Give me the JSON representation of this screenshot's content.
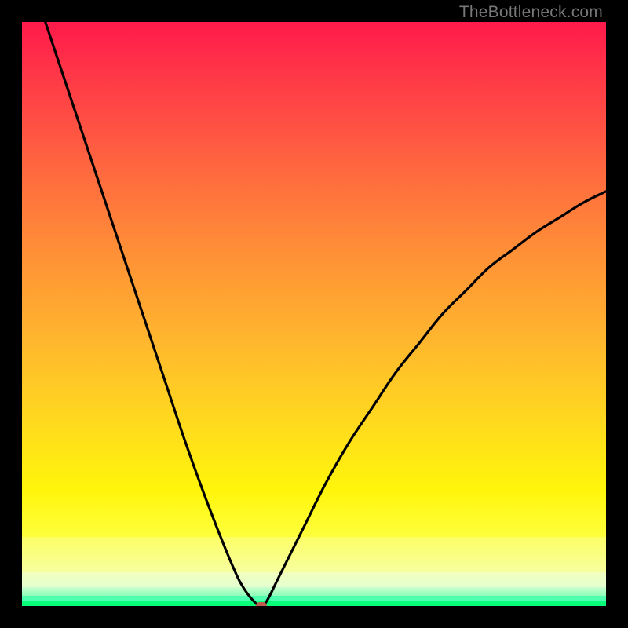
{
  "watermark": "TheBottleneck.com",
  "colors": {
    "frame": "#000000",
    "marker": "#c35a4f",
    "curve": "#000000",
    "grad_top": "#ff1a4b",
    "grad_mid": "#ffd81f",
    "grad_bottom": "#08ff7a"
  },
  "chart_data": {
    "type": "line",
    "title": "",
    "xlabel": "",
    "ylabel": "",
    "xlim": [
      0,
      100
    ],
    "ylim": [
      0,
      100
    ],
    "series": [
      {
        "name": "bottleneck-curve",
        "x": [
          4,
          8,
          12,
          16,
          20,
          24,
          28,
          32,
          36,
          38,
          40,
          41,
          42,
          44,
          48,
          52,
          56,
          60,
          64,
          68,
          72,
          76,
          80,
          84,
          88,
          92,
          96,
          100
        ],
        "y": [
          100,
          88,
          76,
          64,
          52,
          40,
          28,
          17,
          7,
          3,
          0.5,
          0,
          1,
          5,
          13,
          21,
          28,
          34,
          40,
          45,
          50,
          54,
          58,
          61,
          64,
          66.5,
          69,
          71
        ]
      }
    ],
    "marker_point": {
      "x": 41,
      "y": 0
    },
    "annotations": []
  }
}
